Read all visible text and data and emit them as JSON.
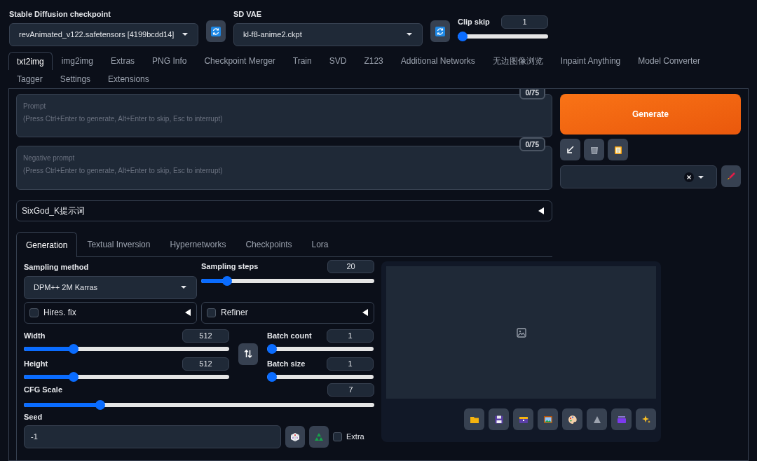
{
  "checkpoint": {
    "label": "Stable Diffusion checkpoint",
    "value": "revAnimated_v122.safetensors [4199bcdd14]"
  },
  "vae": {
    "label": "SD VAE",
    "value": "kl-f8-anime2.ckpt"
  },
  "clip_skip": {
    "label": "Clip skip",
    "value": "1",
    "level": 0
  },
  "tabs": [
    {
      "label": "txt2img",
      "selected": true
    },
    {
      "label": "img2img",
      "selected": false
    },
    {
      "label": "Extras",
      "selected": false
    },
    {
      "label": "PNG Info",
      "selected": false
    },
    {
      "label": "Checkpoint Merger",
      "selected": false
    },
    {
      "label": "Train",
      "selected": false
    },
    {
      "label": "SVD",
      "selected": false
    },
    {
      "label": "Z123",
      "selected": false
    },
    {
      "label": "Additional Networks",
      "selected": false
    },
    {
      "label": "无边图像浏览",
      "selected": false
    },
    {
      "label": "Inpaint Anything",
      "selected": false
    },
    {
      "label": "Model Converter",
      "selected": false
    },
    {
      "label": "Tagger",
      "selected": false
    },
    {
      "label": "Settings",
      "selected": false
    },
    {
      "label": "Extensions",
      "selected": false
    }
  ],
  "prompts": [
    {
      "label": "Prompt",
      "placeholder": "(Press Ctrl+Enter to generate, Alt+Enter to skip, Esc to interrupt)",
      "token_count": "0/75"
    },
    {
      "label": "Negative prompt",
      "placeholder": "(Press Ctrl+Enter to generate, Alt+Enter to skip, Esc to interrupt)",
      "token_count": "0/75"
    }
  ],
  "generate_button": "Generate",
  "accordion": {
    "label": "SixGod_K提示词",
    "expanded": false
  },
  "subtabs": [
    {
      "label": "Generation",
      "selected": true
    },
    {
      "label": "Textual Inversion",
      "selected": false
    },
    {
      "label": "Hypernetworks",
      "selected": false
    },
    {
      "label": "Checkpoints",
      "selected": false
    },
    {
      "label": "Lora",
      "selected": false
    }
  ],
  "sampling_method": {
    "label": "Sampling method",
    "value": "DPM++ 2M Karras"
  },
  "sampling_steps": {
    "label": "Sampling steps",
    "value": "20",
    "level": 0.13
  },
  "hires_fix": {
    "label": "Hires. fix",
    "checked": false,
    "expanded": false
  },
  "refiner": {
    "label": "Refiner",
    "checked": false,
    "expanded": false
  },
  "width": {
    "label": "Width",
    "value": "512",
    "level": 0.23
  },
  "height": {
    "label": "Height",
    "value": "512",
    "level": 0.23
  },
  "batch_count": {
    "label": "Batch count",
    "value": "1",
    "level": 0
  },
  "batch_size": {
    "label": "Batch size",
    "value": "1",
    "level": 0
  },
  "cfg_scale": {
    "label": "CFG Scale",
    "value": "7",
    "level": 0.21
  },
  "seed": {
    "label": "Seed",
    "value": "-1"
  },
  "extra": {
    "label": "Extra",
    "checked": false
  }
}
